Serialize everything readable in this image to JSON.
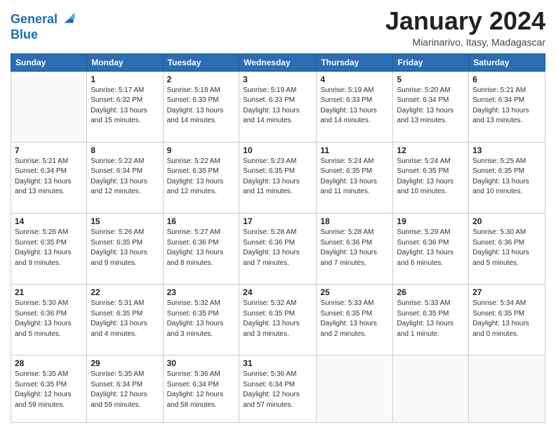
{
  "logo": {
    "line1": "General",
    "line2": "Blue"
  },
  "title": "January 2024",
  "location": "Miarinarivo, Itasy, Madagascar",
  "days_header": [
    "Sunday",
    "Monday",
    "Tuesday",
    "Wednesday",
    "Thursday",
    "Friday",
    "Saturday"
  ],
  "weeks": [
    [
      {
        "day": "",
        "sunrise": "",
        "sunset": "",
        "daylight": ""
      },
      {
        "day": "1",
        "sunrise": "Sunrise: 5:17 AM",
        "sunset": "Sunset: 6:32 PM",
        "daylight": "Daylight: 13 hours and 15 minutes."
      },
      {
        "day": "2",
        "sunrise": "Sunrise: 5:18 AM",
        "sunset": "Sunset: 6:33 PM",
        "daylight": "Daylight: 13 hours and 14 minutes."
      },
      {
        "day": "3",
        "sunrise": "Sunrise: 5:19 AM",
        "sunset": "Sunset: 6:33 PM",
        "daylight": "Daylight: 13 hours and 14 minutes."
      },
      {
        "day": "4",
        "sunrise": "Sunrise: 5:19 AM",
        "sunset": "Sunset: 6:33 PM",
        "daylight": "Daylight: 13 hours and 14 minutes."
      },
      {
        "day": "5",
        "sunrise": "Sunrise: 5:20 AM",
        "sunset": "Sunset: 6:34 PM",
        "daylight": "Daylight: 13 hours and 13 minutes."
      },
      {
        "day": "6",
        "sunrise": "Sunrise: 5:21 AM",
        "sunset": "Sunset: 6:34 PM",
        "daylight": "Daylight: 13 hours and 13 minutes."
      }
    ],
    [
      {
        "day": "7",
        "sunrise": "Sunrise: 5:21 AM",
        "sunset": "Sunset: 6:34 PM",
        "daylight": "Daylight: 13 hours and 13 minutes."
      },
      {
        "day": "8",
        "sunrise": "Sunrise: 5:22 AM",
        "sunset": "Sunset: 6:34 PM",
        "daylight": "Daylight: 13 hours and 12 minutes."
      },
      {
        "day": "9",
        "sunrise": "Sunrise: 5:22 AM",
        "sunset": "Sunset: 6:35 PM",
        "daylight": "Daylight: 13 hours and 12 minutes."
      },
      {
        "day": "10",
        "sunrise": "Sunrise: 5:23 AM",
        "sunset": "Sunset: 6:35 PM",
        "daylight": "Daylight: 13 hours and 11 minutes."
      },
      {
        "day": "11",
        "sunrise": "Sunrise: 5:24 AM",
        "sunset": "Sunset: 6:35 PM",
        "daylight": "Daylight: 13 hours and 11 minutes."
      },
      {
        "day": "12",
        "sunrise": "Sunrise: 5:24 AM",
        "sunset": "Sunset: 6:35 PM",
        "daylight": "Daylight: 13 hours and 10 minutes."
      },
      {
        "day": "13",
        "sunrise": "Sunrise: 5:25 AM",
        "sunset": "Sunset: 6:35 PM",
        "daylight": "Daylight: 13 hours and 10 minutes."
      }
    ],
    [
      {
        "day": "14",
        "sunrise": "Sunrise: 5:26 AM",
        "sunset": "Sunset: 6:35 PM",
        "daylight": "Daylight: 13 hours and 9 minutes."
      },
      {
        "day": "15",
        "sunrise": "Sunrise: 5:26 AM",
        "sunset": "Sunset: 6:35 PM",
        "daylight": "Daylight: 13 hours and 9 minutes."
      },
      {
        "day": "16",
        "sunrise": "Sunrise: 5:27 AM",
        "sunset": "Sunset: 6:36 PM",
        "daylight": "Daylight: 13 hours and 8 minutes."
      },
      {
        "day": "17",
        "sunrise": "Sunrise: 5:28 AM",
        "sunset": "Sunset: 6:36 PM",
        "daylight": "Daylight: 13 hours and 7 minutes."
      },
      {
        "day": "18",
        "sunrise": "Sunrise: 5:28 AM",
        "sunset": "Sunset: 6:36 PM",
        "daylight": "Daylight: 13 hours and 7 minutes."
      },
      {
        "day": "19",
        "sunrise": "Sunrise: 5:29 AM",
        "sunset": "Sunset: 6:36 PM",
        "daylight": "Daylight: 13 hours and 6 minutes."
      },
      {
        "day": "20",
        "sunrise": "Sunrise: 5:30 AM",
        "sunset": "Sunset: 6:36 PM",
        "daylight": "Daylight: 13 hours and 5 minutes."
      }
    ],
    [
      {
        "day": "21",
        "sunrise": "Sunrise: 5:30 AM",
        "sunset": "Sunset: 6:36 PM",
        "daylight": "Daylight: 13 hours and 5 minutes."
      },
      {
        "day": "22",
        "sunrise": "Sunrise: 5:31 AM",
        "sunset": "Sunset: 6:35 PM",
        "daylight": "Daylight: 13 hours and 4 minutes."
      },
      {
        "day": "23",
        "sunrise": "Sunrise: 5:32 AM",
        "sunset": "Sunset: 6:35 PM",
        "daylight": "Daylight: 13 hours and 3 minutes."
      },
      {
        "day": "24",
        "sunrise": "Sunrise: 5:32 AM",
        "sunset": "Sunset: 6:35 PM",
        "daylight": "Daylight: 13 hours and 3 minutes."
      },
      {
        "day": "25",
        "sunrise": "Sunrise: 5:33 AM",
        "sunset": "Sunset: 6:35 PM",
        "daylight": "Daylight: 13 hours and 2 minutes."
      },
      {
        "day": "26",
        "sunrise": "Sunrise: 5:33 AM",
        "sunset": "Sunset: 6:35 PM",
        "daylight": "Daylight: 13 hours and 1 minute."
      },
      {
        "day": "27",
        "sunrise": "Sunrise: 5:34 AM",
        "sunset": "Sunset: 6:35 PM",
        "daylight": "Daylight: 13 hours and 0 minutes."
      }
    ],
    [
      {
        "day": "28",
        "sunrise": "Sunrise: 5:35 AM",
        "sunset": "Sunset: 6:35 PM",
        "daylight": "Daylight: 12 hours and 59 minutes."
      },
      {
        "day": "29",
        "sunrise": "Sunrise: 5:35 AM",
        "sunset": "Sunset: 6:34 PM",
        "daylight": "Daylight: 12 hours and 59 minutes."
      },
      {
        "day": "30",
        "sunrise": "Sunrise: 5:36 AM",
        "sunset": "Sunset: 6:34 PM",
        "daylight": "Daylight: 12 hours and 58 minutes."
      },
      {
        "day": "31",
        "sunrise": "Sunrise: 5:36 AM",
        "sunset": "Sunset: 6:34 PM",
        "daylight": "Daylight: 12 hours and 57 minutes."
      },
      {
        "day": "",
        "sunrise": "",
        "sunset": "",
        "daylight": ""
      },
      {
        "day": "",
        "sunrise": "",
        "sunset": "",
        "daylight": ""
      },
      {
        "day": "",
        "sunrise": "",
        "sunset": "",
        "daylight": ""
      }
    ]
  ]
}
